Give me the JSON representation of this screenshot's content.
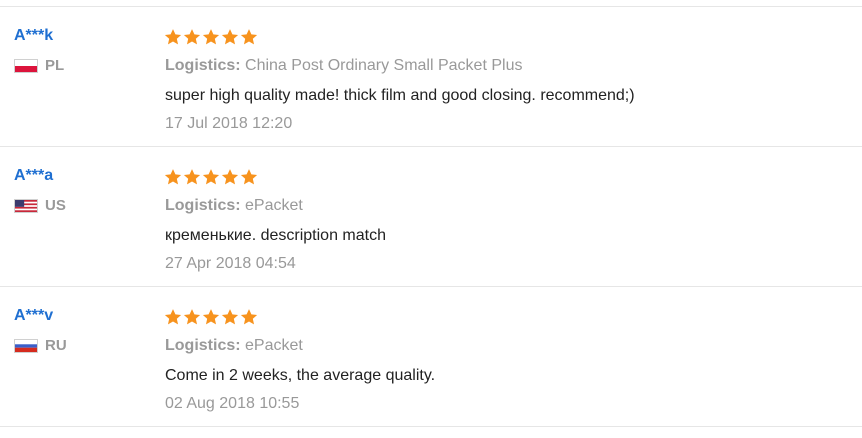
{
  "reviews": [
    {
      "buyer": "A***k",
      "country": "PL",
      "flag_icon": "poland-flag-icon",
      "rating": 5,
      "logistics_label": "Logistics:",
      "logistics_value": "China Post Ordinary Small Packet Plus",
      "text": "super high quality made! thick film and good closing. recommend;)",
      "date": "17 Jul 2018 12:20"
    },
    {
      "buyer": "A***a",
      "country": "US",
      "flag_icon": "usa-flag-icon",
      "rating": 5,
      "logistics_label": "Logistics:",
      "logistics_value": "ePacket",
      "text": "кременькие. description match",
      "date": "27 Apr 2018 04:54"
    },
    {
      "buyer": "A***v",
      "country": "RU",
      "flag_icon": "russia-flag-icon",
      "rating": 5,
      "logistics_label": "Logistics:",
      "logistics_value": "ePacket",
      "text": "Come in 2 weeks, the average quality.",
      "date": "02 Aug 2018 10:55"
    }
  ],
  "colors": {
    "buyer_link": "#1f6fd1",
    "star": "#f7931e",
    "muted_text": "#999999",
    "body_text": "#222222",
    "divider": "#e6e6e6"
  }
}
